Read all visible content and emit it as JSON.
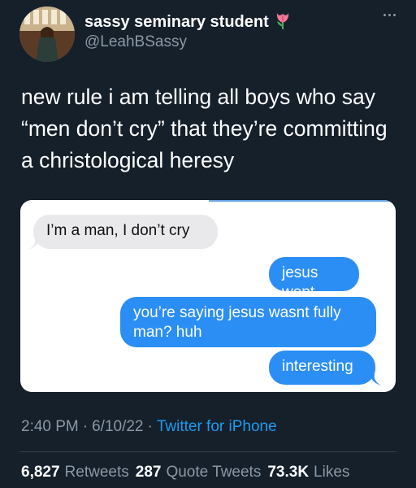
{
  "author": {
    "display_name": "sassy seminary student",
    "handle": "@LeahBSassy",
    "badge_icon": "tulip-icon"
  },
  "tweet": {
    "text": "new rule i am telling all boys who say “men don’t cry” that they’re committing a christological heresy"
  },
  "media": {
    "messages": [
      {
        "from": "other",
        "text": "I’m a man, I don’t cry"
      },
      {
        "from": "me",
        "text": "jesus wept"
      },
      {
        "from": "me",
        "text": "you’re saying jesus wasnt fully man? huh"
      },
      {
        "from": "me",
        "text": "interesting"
      }
    ],
    "colors": {
      "incoming": "#e9e9eb",
      "outgoing": "#2b8ef5"
    }
  },
  "meta": {
    "time": "2:40 PM",
    "date": "6/10/22",
    "separator": "·",
    "source": "Twitter for iPhone"
  },
  "stats": {
    "retweets_count": "6,827",
    "retweets_label": "Retweets",
    "quotes_count": "287",
    "quotes_label": "Quote Tweets",
    "likes_count": "73.3K",
    "likes_label": "Likes"
  },
  "colors": {
    "background": "#15202b",
    "muted": "#8b98a5",
    "link": "#1d9bf0"
  }
}
